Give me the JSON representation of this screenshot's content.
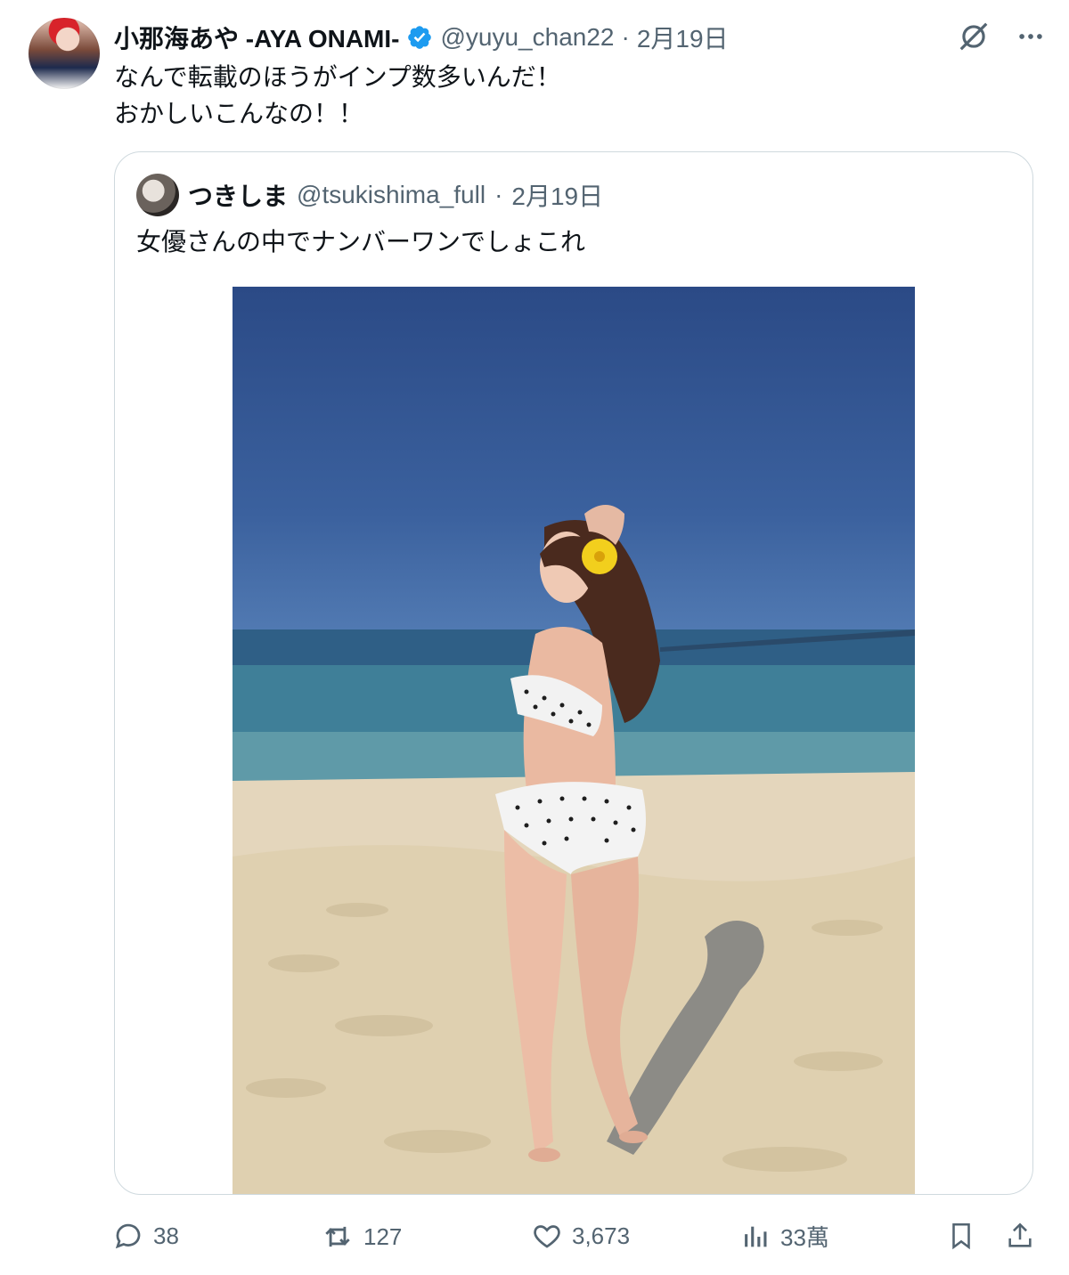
{
  "author": {
    "display_name": "小那海あや -AYA ONAMI-",
    "handle": "@yuyu_chan22",
    "separator": "·",
    "date": "2月19日"
  },
  "tweet": {
    "text": "なんで転載のほうがインプ数多いんだ！\nおかしいこんなの！！"
  },
  "quote": {
    "display_name": "つきしま",
    "handle": "@tsukishima_full",
    "separator": "·",
    "date": "2月19日",
    "text": "女優さんの中でナンバーワンでしょこれ"
  },
  "actions": {
    "replies": "38",
    "reposts": "127",
    "likes": "3,673",
    "views": "33萬"
  },
  "colors": {
    "muted": "#536471",
    "verified": "#1d9bf0",
    "border": "#cfd9de"
  },
  "icons": [
    "grok-icon",
    "more-icon",
    "reply-icon",
    "repost-icon",
    "like-icon",
    "views-icon",
    "bookmark-icon",
    "share-icon",
    "verified-badge-icon"
  ]
}
